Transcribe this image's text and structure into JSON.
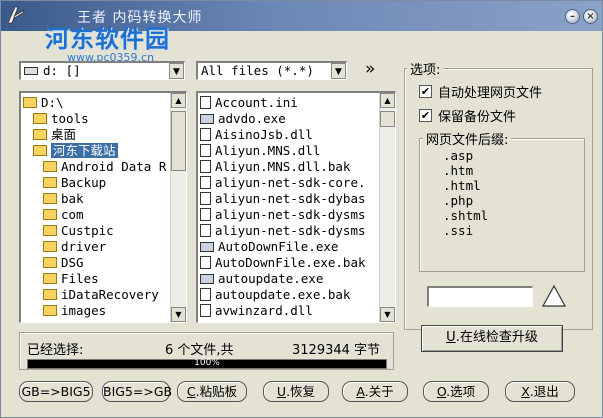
{
  "window": {
    "title": "王者 内码转换大师",
    "watermark": "河东软件园",
    "watermark_url": "www.pc0359.cn"
  },
  "drive_select": {
    "value": "d: []"
  },
  "filter_select": {
    "value": "All files (*.*)"
  },
  "forward_button": "»",
  "folder_tree": [
    {
      "label": "D:\\",
      "indent": 0,
      "selected": false
    },
    {
      "label": "tools",
      "indent": 1,
      "selected": false
    },
    {
      "label": "桌面",
      "indent": 1,
      "selected": false
    },
    {
      "label": "河东下载站",
      "indent": 1,
      "selected": true
    },
    {
      "label": "Android Data R",
      "indent": 2,
      "selected": false
    },
    {
      "label": "Backup",
      "indent": 2,
      "selected": false
    },
    {
      "label": "bak",
      "indent": 2,
      "selected": false
    },
    {
      "label": "com",
      "indent": 2,
      "selected": false
    },
    {
      "label": "Custpic",
      "indent": 2,
      "selected": false
    },
    {
      "label": "driver",
      "indent": 2,
      "selected": false
    },
    {
      "label": "DSG",
      "indent": 2,
      "selected": false
    },
    {
      "label": "Files",
      "indent": 2,
      "selected": false
    },
    {
      "label": "iDataRecovery",
      "indent": 2,
      "selected": false
    },
    {
      "label": "images",
      "indent": 2,
      "selected": false
    }
  ],
  "file_list": [
    {
      "name": "Account.ini",
      "icon": "file"
    },
    {
      "name": "advdo.exe",
      "icon": "exe"
    },
    {
      "name": "AisinoJsb.dll",
      "icon": "file"
    },
    {
      "name": "Aliyun.MNS.dll",
      "icon": "file"
    },
    {
      "name": "Aliyun.MNS.dll.bak",
      "icon": "file"
    },
    {
      "name": "aliyun-net-sdk-core.",
      "icon": "file"
    },
    {
      "name": "aliyun-net-sdk-dybas",
      "icon": "file"
    },
    {
      "name": "aliyun-net-sdk-dysms",
      "icon": "file"
    },
    {
      "name": "aliyun-net-sdk-dysms",
      "icon": "file"
    },
    {
      "name": "AutoDownFile.exe",
      "icon": "exe"
    },
    {
      "name": "AutoDownFile.exe.bak",
      "icon": "file"
    },
    {
      "name": "autoupdate.exe",
      "icon": "exe"
    },
    {
      "name": "autoupdate.exe.bak",
      "icon": "file"
    },
    {
      "name": "avwinzard.dll",
      "icon": "file"
    }
  ],
  "options": {
    "title": "选项:",
    "auto_process_label": "自动处理网页文件",
    "auto_process_checked": true,
    "keep_backup_label": "保留备份文件",
    "keep_backup_checked": true,
    "suffix_group_title": "网页文件后缀:",
    "suffixes": [
      ".asp",
      ".htm",
      ".html",
      ".php",
      ".shtml",
      ".ssi"
    ],
    "suffix_input_value": "",
    "upgrade_button": {
      "key": "U",
      "label": ".在线检查升级"
    }
  },
  "status": {
    "selected_label": "已经选择:",
    "count_text": "6 个文件,共",
    "bytes_text": "3129344 字节",
    "progress_percent": 100,
    "progress_label": "100%"
  },
  "bottom_buttons": [
    {
      "name": "gb-to-big5-button",
      "label": "GB=>BIG5",
      "key": ""
    },
    {
      "name": "big5-to-gb-button",
      "label": "BIG5=>GB",
      "key": ""
    },
    {
      "name": "clipboard-button",
      "label": ".粘贴板",
      "key": "C"
    },
    {
      "name": "restore-button",
      "label": ".恢复",
      "key": "U"
    },
    {
      "name": "about-button",
      "label": ".关于",
      "key": "A"
    },
    {
      "name": "options-button",
      "label": ".选项",
      "key": "O"
    },
    {
      "name": "exit-button",
      "label": ".退出",
      "key": "X"
    }
  ]
}
